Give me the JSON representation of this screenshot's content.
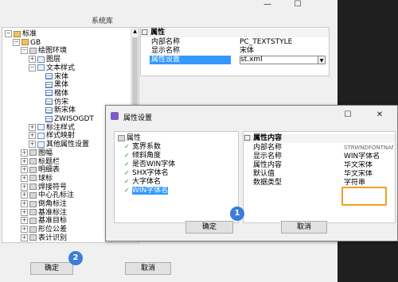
{
  "system_dialog": {
    "title": "系统库",
    "titlebar": {
      "minimize": "—",
      "maximize": "☐"
    },
    "tree": [
      {
        "label": "标准",
        "depth": 0,
        "exp": "□"
      },
      {
        "label": "GB",
        "depth": 1,
        "exp": "□"
      },
      {
        "label": "绘图环境",
        "depth": 2,
        "exp": "□"
      },
      {
        "label": "图层",
        "depth": 3,
        "exp": "+"
      },
      {
        "label": "文本样式",
        "depth": 3,
        "exp": "□"
      },
      {
        "label": "宋体",
        "depth": 4
      },
      {
        "label": "黑体",
        "depth": 4
      },
      {
        "label": "楷体",
        "depth": 4
      },
      {
        "label": "仿宋",
        "depth": 4
      },
      {
        "label": "新宋体",
        "depth": 4
      },
      {
        "label": "ZWISOGDT",
        "depth": 4
      },
      {
        "label": "标注样式",
        "depth": 3,
        "exp": "+"
      },
      {
        "label": "样式映射",
        "depth": 3,
        "exp": "+"
      },
      {
        "label": "其他属性设置",
        "depth": 3,
        "exp": "+"
      },
      {
        "label": "图幅",
        "depth": 2,
        "exp": "+"
      },
      {
        "label": "标题栏",
        "depth": 2,
        "exp": "+"
      },
      {
        "label": "明细表",
        "depth": 2,
        "exp": "+"
      },
      {
        "label": "球标",
        "depth": 2,
        "exp": "+"
      },
      {
        "label": "焊接符号",
        "depth": 2,
        "exp": "+"
      },
      {
        "label": "中心孔标注",
        "depth": 2,
        "exp": "+"
      },
      {
        "label": "倒角标注",
        "depth": 2,
        "exp": "+"
      },
      {
        "label": "基准标注",
        "depth": 2,
        "exp": "+"
      },
      {
        "label": "基准目标",
        "depth": 2,
        "exp": "+"
      },
      {
        "label": "形位公差",
        "depth": 2,
        "exp": "+"
      },
      {
        "label": "表计识别",
        "depth": 2,
        "exp": "+"
      }
    ],
    "properties": {
      "header": "属性",
      "rows": [
        {
          "name": "内部名称",
          "value": "PC_TEXTSTYLE"
        },
        {
          "name": "显示名称",
          "value": "宋体"
        },
        {
          "name": "属性设置",
          "value": "st.xml",
          "selected": true
        }
      ]
    },
    "ok_label": "确定",
    "cancel_label": "取消",
    "step_badge": "2"
  },
  "attr_dialog": {
    "title": "属性设置",
    "close": "✕",
    "maximize": "☐",
    "list_root": "属性",
    "items": [
      "宽界系数",
      "倾斜角度",
      "是否WIN字体",
      "SHX字体名",
      "大字体名",
      "WIN字体名"
    ],
    "selected_item": "WIN字体名",
    "content_header": "属性内容",
    "rows": [
      {
        "name": "内部名称",
        "value": "STRWNDFONTNAME"
      },
      {
        "name": "显示名称",
        "value": "WIN字体名"
      },
      {
        "name": "属性内容",
        "value": "华文宋体"
      },
      {
        "name": "默认值",
        "value": "华文宋体"
      },
      {
        "name": "数据类型",
        "value": "字符串"
      }
    ],
    "ok_label": "确定",
    "cancel_label": "取消",
    "step_badge": "1",
    "highlight_color": "#f0a020"
  },
  "colors": {
    "accent": "#3b7dd8",
    "selection": "#3399ff",
    "badge": "#3b7dd8"
  }
}
